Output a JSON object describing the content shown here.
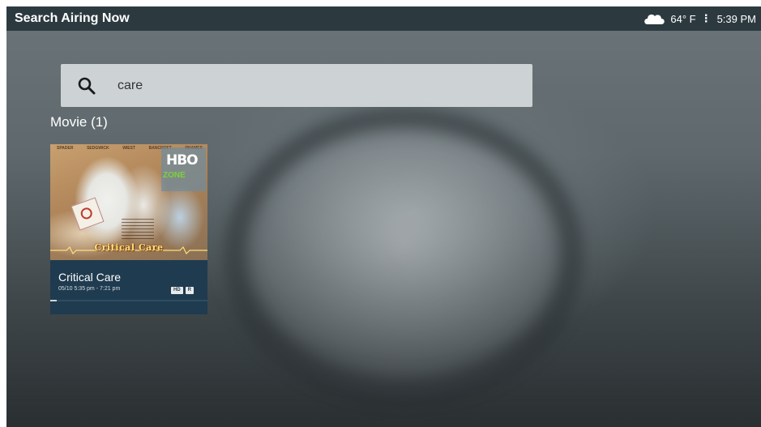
{
  "header": {
    "title": "Search Airing Now",
    "weather_icon": "cloud-icon",
    "temperature": "64° F",
    "menu_icon": "vertical-dots-icon",
    "time": "5:39 PM"
  },
  "search": {
    "icon": "search-icon",
    "value": "care"
  },
  "results": {
    "section_label": "Movie (1)",
    "items": [
      {
        "title": "Critical Care",
        "schedule": "05/10  5:35 pm - 7:21 pm",
        "badges": [
          "HD",
          "R"
        ],
        "progress": 0.04,
        "poster": {
          "channel_logo": "HBO",
          "channel_sub": "ZONE",
          "caption": "Critical Care",
          "cast": [
            "SPADER",
            "SEDGWICK",
            "WIEST",
            "BANCROFT",
            "RHAMES"
          ]
        }
      }
    ]
  },
  "colors": {
    "header_bg": "#2c3a40",
    "card_bg": "#1f3b4f",
    "search_bg": "#dce0e2"
  }
}
